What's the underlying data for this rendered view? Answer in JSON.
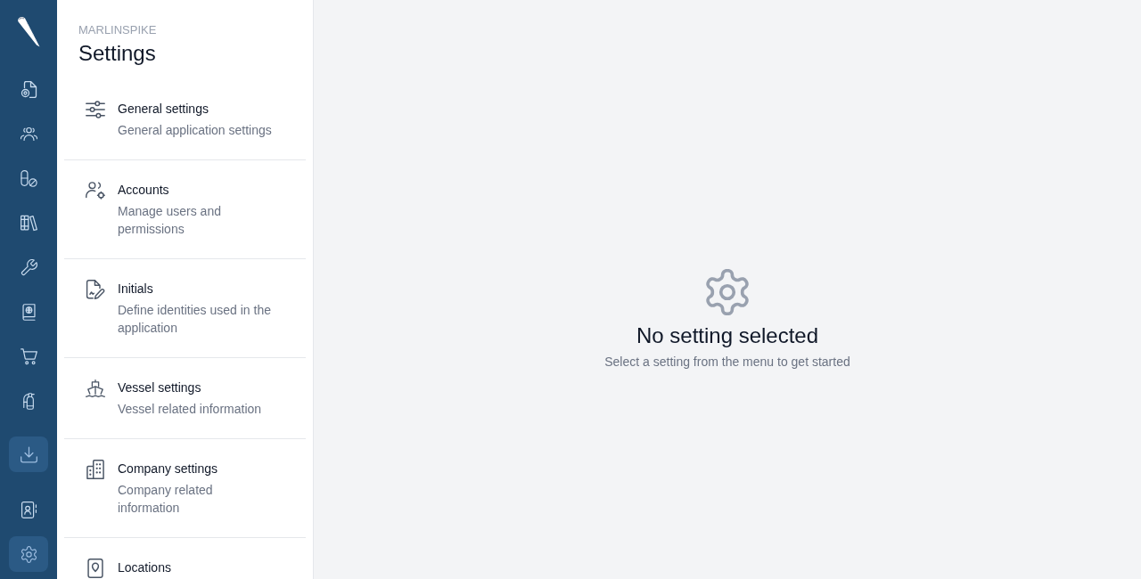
{
  "nav_rail": {
    "top_items": [
      {
        "kind": "certificate",
        "selected": false
      },
      {
        "kind": "users",
        "selected": false
      },
      {
        "kind": "pill",
        "selected": false
      },
      {
        "kind": "books",
        "selected": false
      },
      {
        "kind": "wrench",
        "selected": false
      },
      {
        "kind": "book",
        "selected": false
      },
      {
        "kind": "cart",
        "selected": false
      },
      {
        "kind": "extinguisher",
        "selected": false
      }
    ],
    "bottom_items": [
      {
        "kind": "download",
        "selected": true
      },
      {
        "kind": "contact",
        "selected": false
      },
      {
        "kind": "gear",
        "selected": true
      }
    ]
  },
  "settings_menu": {
    "app_name": "MARLINSPIKE",
    "title": "Settings",
    "items": [
      {
        "kind": "sliders",
        "title": "General settings",
        "description": "General application settings"
      },
      {
        "kind": "users-gear",
        "title": "Accounts",
        "description": "Manage users and permissions"
      },
      {
        "kind": "signature",
        "title": "Initials",
        "description": "Define identities used in the application"
      },
      {
        "kind": "ship",
        "title": "Vessel settings",
        "description": "Vessel related information"
      },
      {
        "kind": "building",
        "title": "Company settings",
        "description": "Company related information"
      },
      {
        "kind": "pin",
        "title": "Locations"
      }
    ]
  },
  "empty_state": {
    "title": "No setting selected",
    "message": "Select a setting from the menu to get started"
  }
}
